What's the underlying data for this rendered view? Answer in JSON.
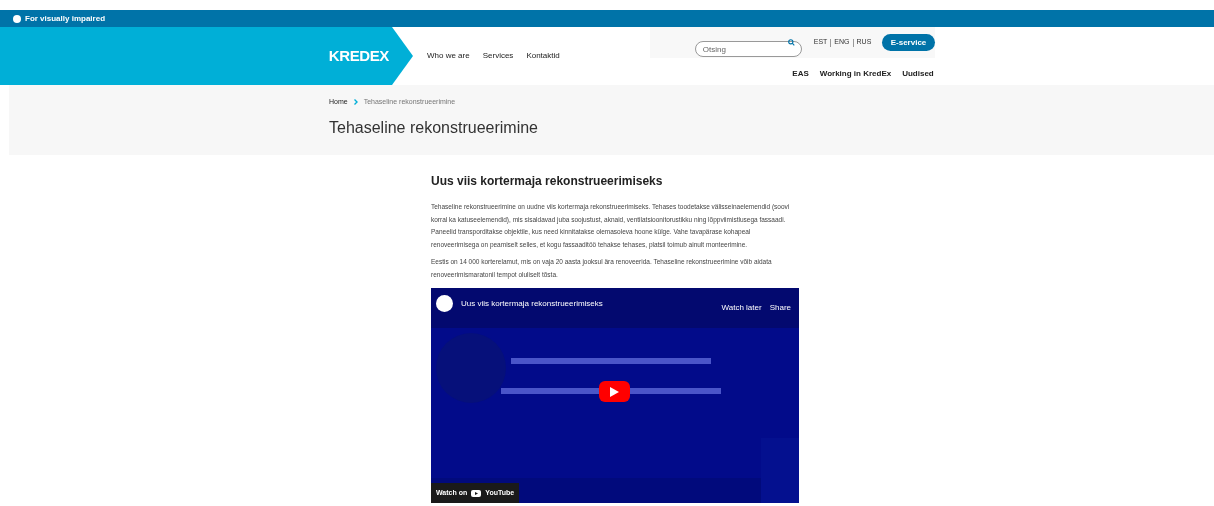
{
  "accessibility_bar": {
    "label": "For visually impaired"
  },
  "header": {
    "logo": "KREDEX",
    "nav": [
      "Who we are",
      "Services",
      "Kontaktid"
    ],
    "search": {
      "placeholder": "Otsing"
    },
    "languages": [
      "EST",
      "ENG",
      "RUS"
    ],
    "eservice_button": "E-service",
    "secondary_nav": [
      "EAS",
      "Working in KredEx",
      "Uudised"
    ]
  },
  "breadcrumb": [
    {
      "label": "Home"
    },
    {
      "label": "Tehaseline rekonstrueerimine"
    }
  ],
  "page_title": "Tehaseline rekonstrueerimine",
  "article": {
    "heading": "Uus viis kortermaja rekonstrueerimiseks",
    "paragraphs": [
      "Tehaseline rekonstrueerimine on uudne viis kortermaja rekonstrueerimiseks. Tehases toodetakse välisseinaelemendid (soovi korral ka katuseelemendid), mis sisaldavad juba soojustust, aknaid, ventilatsioonitorustikku ning lõppviimistlusega fassaadi. Paneelid transporditakse objektile, kus need kinnitatakse olemasoleva hoone külge. Vahe tavapärase kohapeal renoveerimisega on peamiselt selles, et kogu fassaaditöö tehakse tehases, platsil toimub ainult monteerimine.",
      "Eestis on 14 000 korterelamut, mis on vaja 20 aasta jooksul ära renoveerida. Tehaseline rekonstrueerimine võib aidata renoveerimismaratonil tempot oluliselt tõsta."
    ],
    "video": {
      "title": "Uus viis kortermaja rekonstrueerimiseks",
      "watch_later": "Watch later",
      "share": "Share",
      "watch_on": "Watch on",
      "platform": "YouTube"
    }
  }
}
